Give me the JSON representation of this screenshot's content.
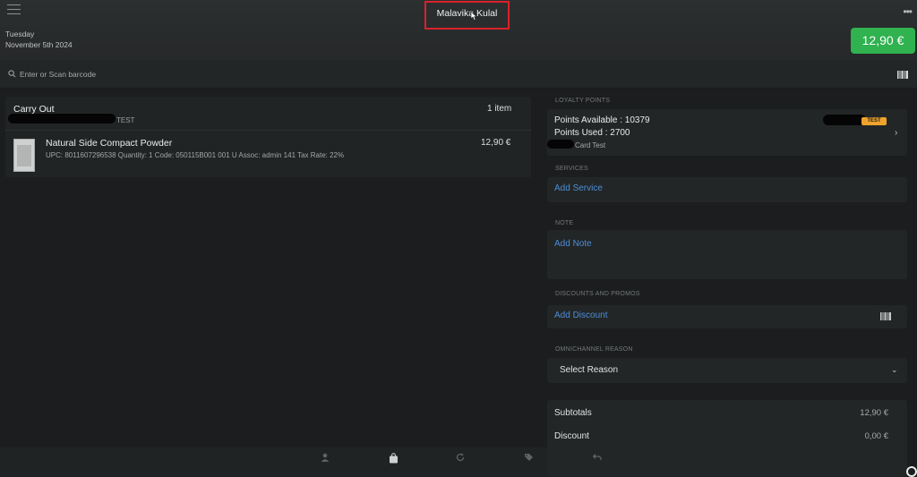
{
  "header": {
    "title": "Malavika Kulal",
    "date_line1": "Tuesday",
    "date_line2": "November 5th 2024",
    "total_button": "12,90 €",
    "icons": {
      "menu": "hamburger-icon",
      "more": "more-dots-icon"
    }
  },
  "search": {
    "placeholder": "Enter or Scan barcode",
    "icons": {
      "left": "search-icon",
      "right": "barcode-icon"
    }
  },
  "order": {
    "type": "Carry Out",
    "item_count": "1 item",
    "customer_tag": "TEST",
    "items": [
      {
        "name": "Natural Side Compact Powder",
        "price": "12,90 €",
        "meta": "UPC: 8011607296538 Quantity: 1 Code: 050115B001 001 U Assoc: admin 141 Tax Rate: 22%"
      }
    ]
  },
  "loyalty": {
    "section_label": "LOYALTY POINTS",
    "points_available": "Points Available : 10379",
    "points_used": "Points Used : 2700",
    "card_label": "Card Test",
    "badge": "TEST"
  },
  "services": {
    "section_label": "SERVICES",
    "link": "Add Service"
  },
  "note": {
    "section_label": "NOTE",
    "link": "Add Note"
  },
  "discounts": {
    "section_label": "DISCOUNTS AND PROMOS",
    "link": "Add Discount"
  },
  "omnichannel": {
    "section_label": "OMNICHANNEL REASON",
    "selected": "Select Reason"
  },
  "totals": {
    "rows": [
      {
        "label": "Subtotals",
        "value": "12,90 €"
      },
      {
        "label": "Discount",
        "value": "0,00 €"
      }
    ]
  },
  "bottom_nav": {
    "items": [
      {
        "icon": "customer-icon",
        "label": ""
      },
      {
        "icon": "bag-icon",
        "label": ""
      },
      {
        "icon": "refresh-icon",
        "label": ""
      },
      {
        "icon": "tag-icon",
        "label": ""
      },
      {
        "icon": "return-icon",
        "label": ""
      }
    ]
  },
  "colors": {
    "accent_green": "#2fb24f",
    "link_blue": "#4c8ed6",
    "badge_orange": "#f0a32a",
    "highlight_red": "#d8222a"
  }
}
